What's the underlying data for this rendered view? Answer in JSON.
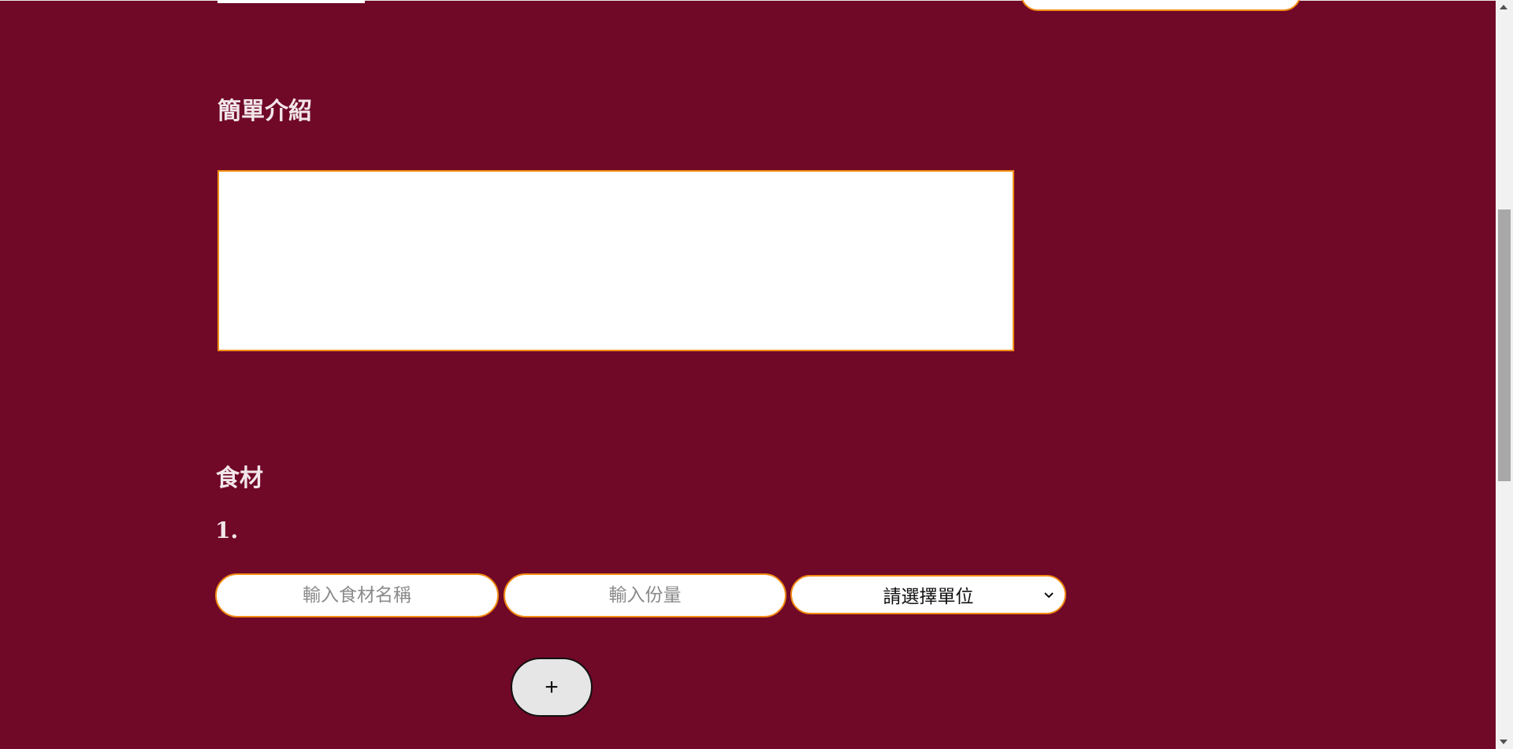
{
  "intro": {
    "title": "簡單介紹",
    "value": ""
  },
  "ingredients": {
    "title": "食材",
    "items": [
      {
        "number": "1.",
        "name_placeholder": "輸入食材名稱",
        "quantity_placeholder": "輸入份量",
        "unit_selected": "請選擇單位"
      }
    ],
    "add_label": "+"
  },
  "colors": {
    "background": "#700828",
    "accent_border": "#f28c12",
    "title_text": "#f2e6ea"
  },
  "icons": {
    "select_arrow": "chevron-down-icon",
    "scroll_up": "scroll-up-arrow-icon",
    "scroll_down": "scroll-down-arrow-icon"
  }
}
